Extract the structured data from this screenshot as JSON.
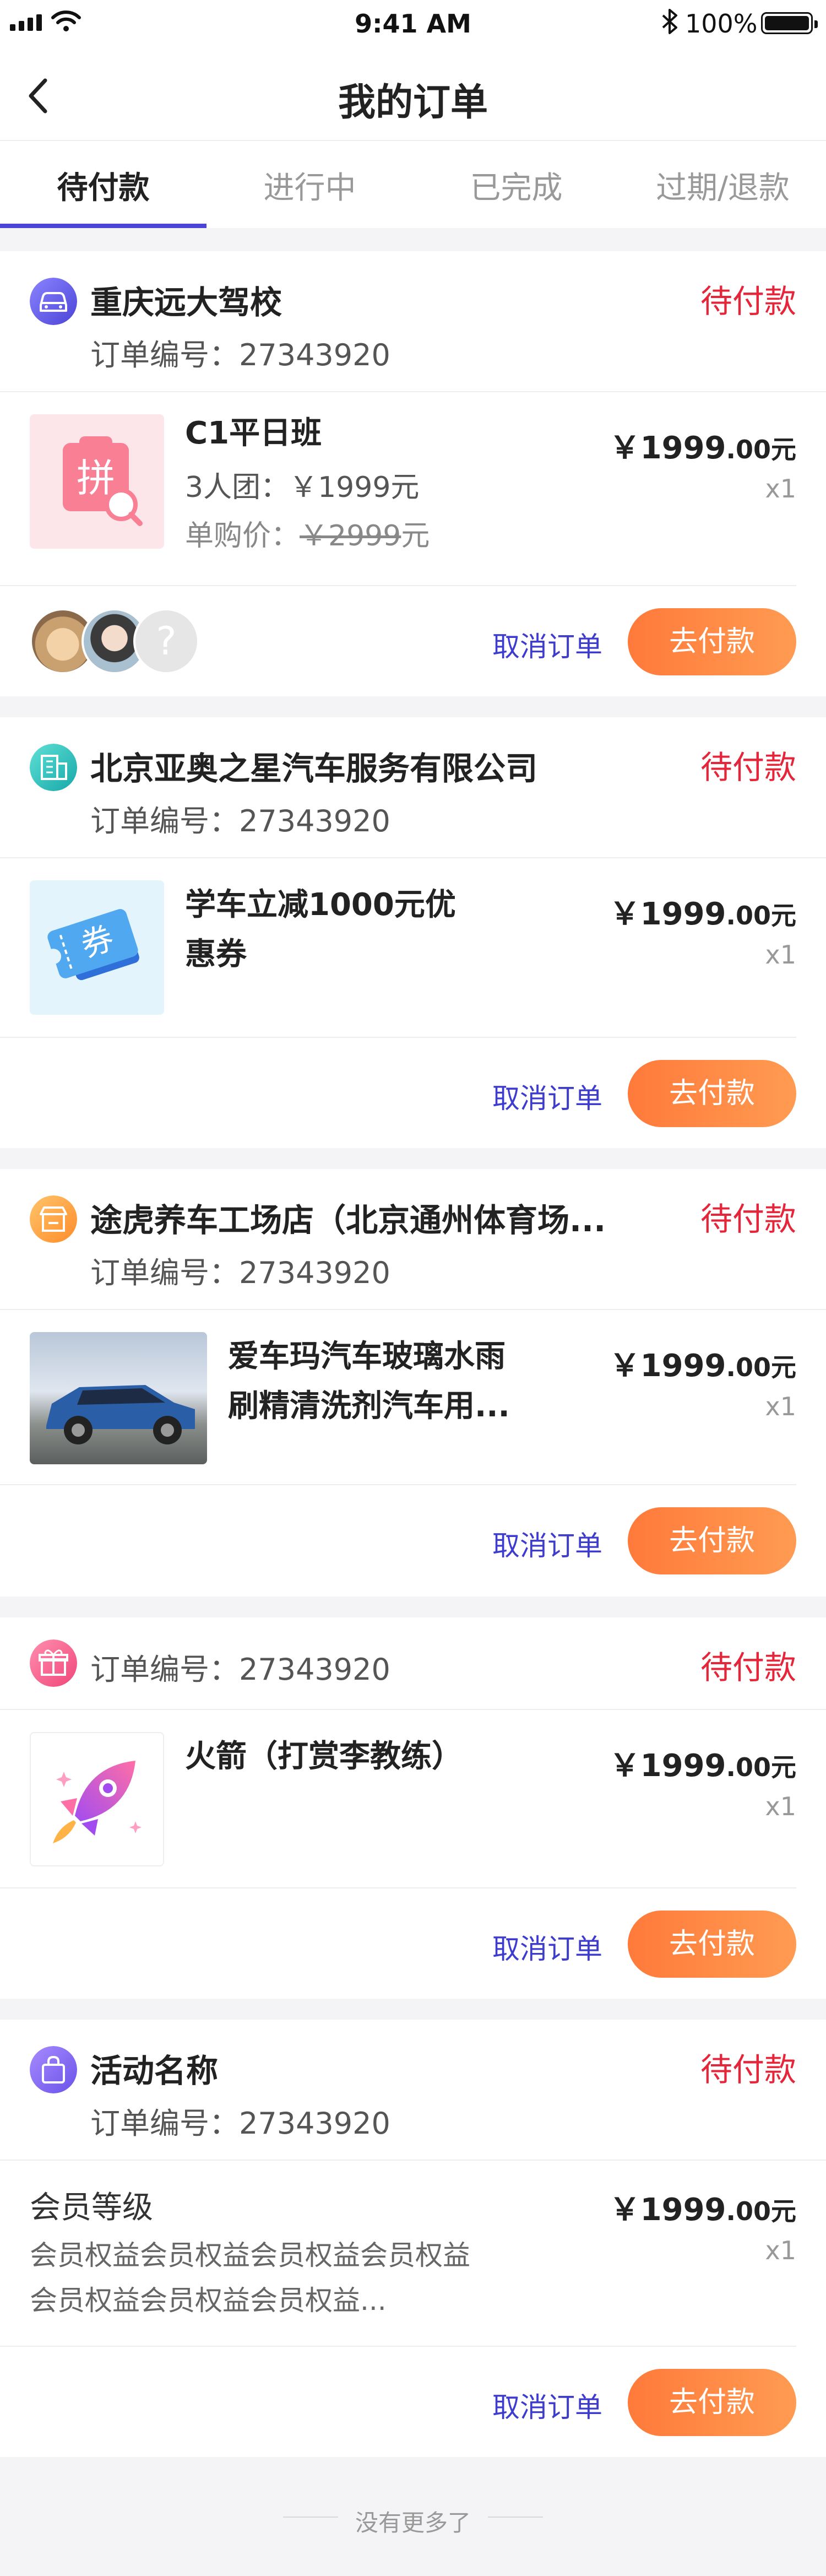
{
  "status_bar": {
    "time": "9:41 AM",
    "battery": "100%"
  },
  "nav": {
    "title": "我的订单"
  },
  "tabs": [
    {
      "label": "待付款"
    },
    {
      "label": "进行中"
    },
    {
      "label": "已完成"
    },
    {
      "label": "过期/退款"
    }
  ],
  "orders": [
    {
      "shop_name": "重庆远大驾校",
      "icon": "car-icon",
      "order_no": "订单编号：27343920",
      "status": "待付款",
      "product": {
        "title": "C1平日班",
        "group": "3人团：￥1999元",
        "single_price_label": "单购价：",
        "single_price": "￥2999",
        "single_price_unit": "元",
        "price_main": "￥1999",
        "price_decimal": ".00元",
        "qty": "x1"
      },
      "cancel": "取消订单",
      "pay": "去付款"
    },
    {
      "shop_name": "北京亚奥之星汽车服务有限公司",
      "icon": "building-icon",
      "order_no": "订单编号：27343920",
      "status": "待付款",
      "product": {
        "title_line1": "学车立减1000元优",
        "title_line2": "惠券",
        "price_main": "￥1999",
        "price_decimal": ".00元",
        "qty": "x1"
      },
      "cancel": "取消订单",
      "pay": "去付款"
    },
    {
      "shop_name": "途虎养车工场店（北京通州体育场...",
      "icon": "store-icon",
      "order_no": "订单编号：27343920",
      "status": "待付款",
      "product": {
        "title_line1": "爱车玛汽车玻璃水雨",
        "title_line2": "刷精清洗剂汽车用...",
        "price_main": "￥1999",
        "price_decimal": ".00元",
        "qty": "x1"
      },
      "cancel": "取消订单",
      "pay": "去付款"
    },
    {
      "icon": "gift-icon",
      "order_no": "订单编号：27343920",
      "status": "待付款",
      "product": {
        "title": "火箭（打赏李教练）",
        "price_main": "￥1999",
        "price_decimal": ".00元",
        "qty": "x1"
      },
      "cancel": "取消订单",
      "pay": "去付款"
    },
    {
      "shop_name": "活动名称",
      "icon": "bag-icon",
      "order_no": "订单编号：27343920",
      "status": "待付款",
      "product": {
        "title": "会员等级",
        "desc_line1": "会员权益会员权益会员权益会员权益",
        "desc_line2": "会员权益会员权益会员权益...",
        "price_main": "￥1999",
        "price_decimal": ".00元",
        "qty": "x1"
      },
      "cancel": "取消订单",
      "pay": "去付款"
    }
  ],
  "footer": {
    "text": "没有更多了"
  },
  "colors": {
    "accent": "#4b44d6",
    "status_red": "#e5263a",
    "pay_orange": "#ff8a45",
    "cancel_blue": "#3e3ccf"
  }
}
